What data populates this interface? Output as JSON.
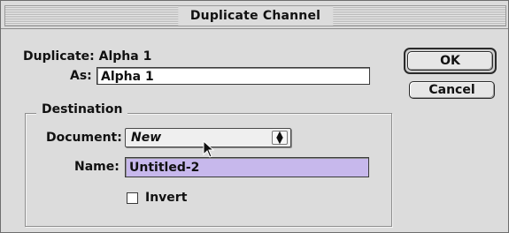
{
  "dialog": {
    "title": "Duplicate Channel"
  },
  "duplicate": {
    "label": "Duplicate:",
    "channel": "Alpha 1"
  },
  "as_field": {
    "label": "As:",
    "value": "Alpha 1"
  },
  "destination": {
    "group_title": "Destination",
    "document_label": "Document:",
    "document_value": "New",
    "name_label": "Name:",
    "name_value": "Untitled-2",
    "invert_label": "Invert",
    "invert_checked": false
  },
  "buttons": {
    "ok": "OK",
    "cancel": "Cancel"
  },
  "colors": {
    "dialog_bg": "#dcdcdc",
    "selection": "#c7b8ec"
  }
}
